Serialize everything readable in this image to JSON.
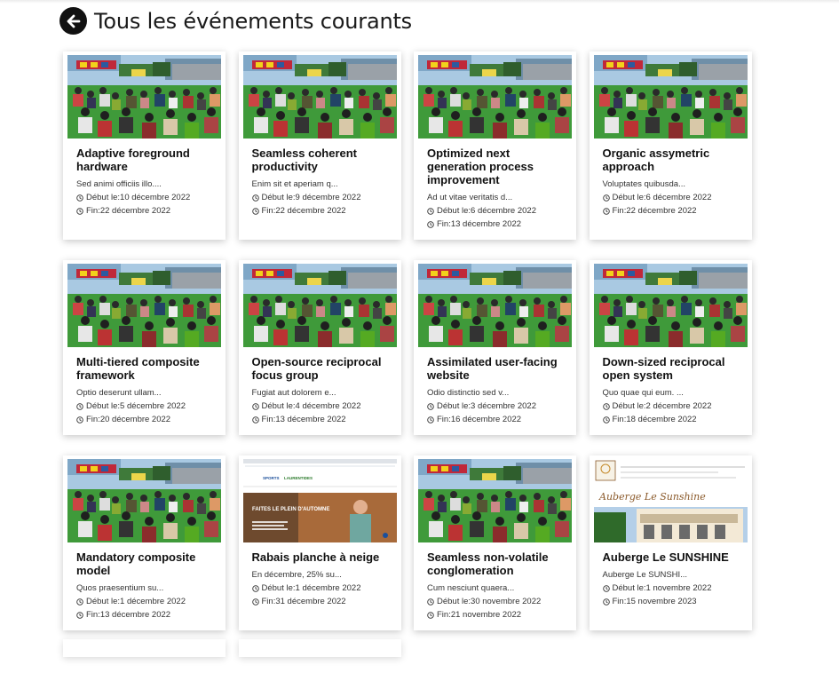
{
  "header": {
    "title": "Tous les événements courants"
  },
  "labels": {
    "start": "Début le: ",
    "end": "Fin: "
  },
  "events": [
    {
      "title": "Adaptive foreground hardware",
      "desc": "Sed animi officiis illo....",
      "start": "10 décembre 2022",
      "end": "22 décembre 2022",
      "image": "festival"
    },
    {
      "title": "Seamless coherent productivity",
      "desc": "Enim sit et aperiam q...",
      "start": "9 décembre 2022",
      "end": "22 décembre 2022",
      "image": "festival"
    },
    {
      "title": "Optimized next generation process improvement",
      "desc": "Ad ut vitae veritatis d...",
      "start": "6 décembre 2022",
      "end": "13 décembre 2022",
      "image": "festival"
    },
    {
      "title": "Organic assymetric approach",
      "desc": "Voluptates quibusda...",
      "start": "6 décembre 2022",
      "end": "22 décembre 2022",
      "image": "festival"
    },
    {
      "title": "Multi-tiered composite framework",
      "desc": "Optio deserunt ullam...",
      "start": "5 décembre 2022",
      "end": "20 décembre 2022",
      "image": "festival"
    },
    {
      "title": "Open-source reciprocal focus group",
      "desc": "Fugiat aut dolorem e...",
      "start": "4 décembre 2022",
      "end": "13 décembre 2022",
      "image": "festival"
    },
    {
      "title": "Assimilated user-facing website",
      "desc": "Odio distinctio sed v...",
      "start": "3 décembre 2022",
      "end": "16 décembre 2022",
      "image": "festival"
    },
    {
      "title": "Down-sized reciprocal open system",
      "desc": "Quo quae qui eum. ...",
      "start": "2 décembre 2022",
      "end": "18 décembre 2022",
      "image": "festival"
    },
    {
      "title": "Mandatory composite model",
      "desc": "Quos praesentium su...",
      "start": "1 décembre 2022",
      "end": "13 décembre 2022",
      "image": "festival"
    },
    {
      "title": "Rabais planche à neige",
      "desc": "En décembre, 25% su...",
      "start": "1 décembre 2022",
      "end": "31 décembre 2022",
      "image": "autumn",
      "image_text": {
        "headline": "FAITES LE PLEIN D'AUTOMNE"
      }
    },
    {
      "title": "Seamless non-volatile conglomeration",
      "desc": "Cum nesciunt quaera...",
      "start": "30 novembre 2022",
      "end": "21 novembre 2022",
      "image": "festival"
    },
    {
      "title": "Auberge Le SUNSHINE",
      "desc": "Auberge Le SUNSHI...",
      "start": "1 novembre 2022",
      "end": "15 novembre 2023",
      "image": "auberge",
      "image_text": {
        "script": "Auberge Le Sunshine"
      }
    }
  ],
  "colors": {
    "grass": "#3f9a3a",
    "sky": "#9fc4de",
    "autumn": "#c9692a",
    "auberge_brown": "#8b5a2b"
  }
}
